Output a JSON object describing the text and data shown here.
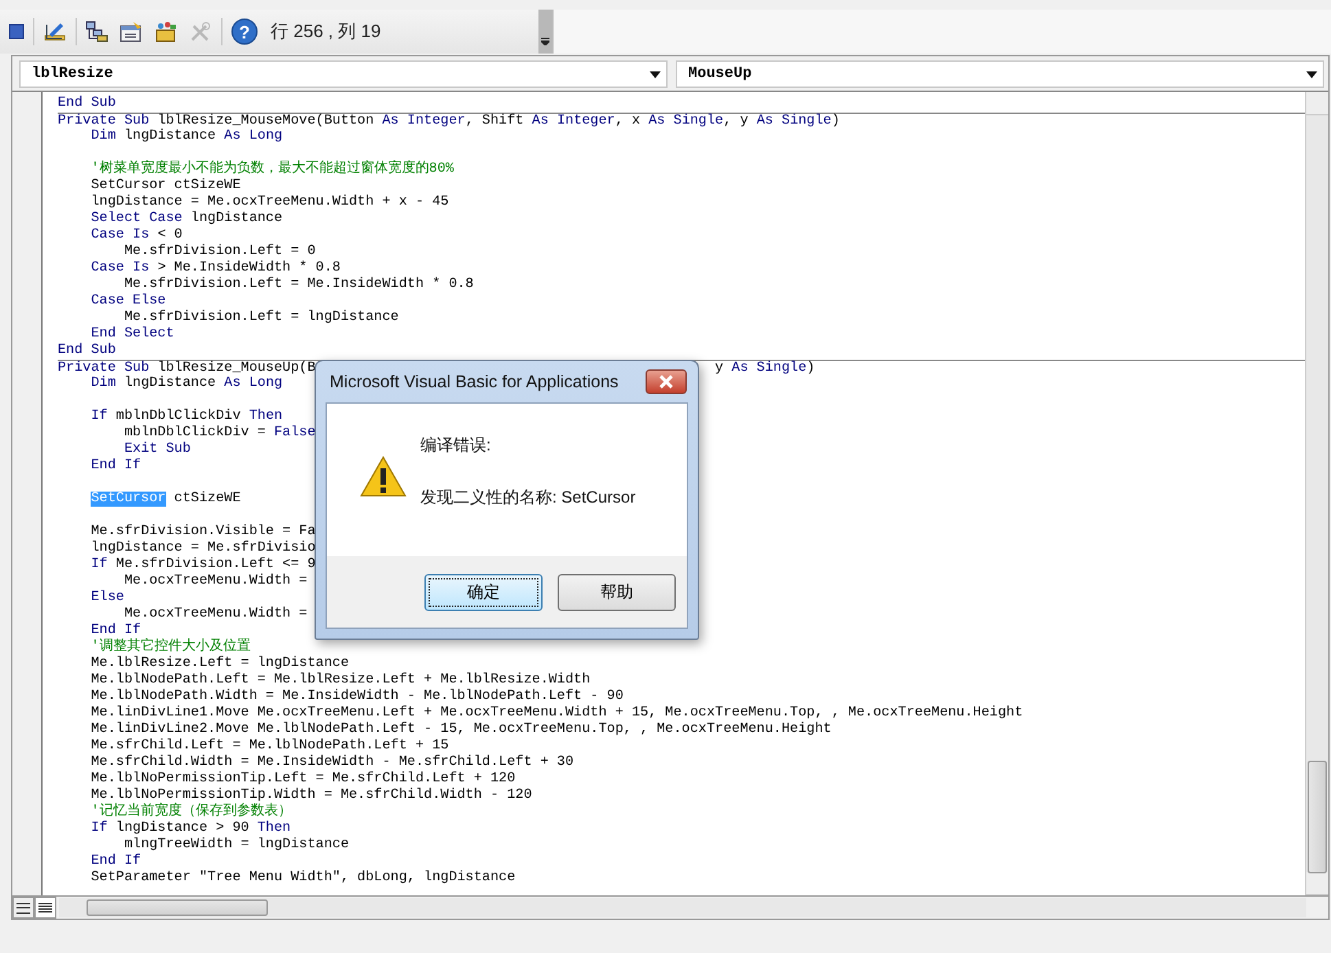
{
  "toolbar": {
    "tools": [
      {
        "kind": "stop",
        "disabled": false
      },
      {
        "kind": "design",
        "disabled": false
      },
      {
        "kind": "project",
        "disabled": false
      },
      {
        "kind": "properties",
        "disabled": false
      },
      {
        "kind": "browser",
        "disabled": false
      },
      {
        "kind": "tools",
        "disabled": true
      },
      {
        "kind": "help",
        "disabled": false,
        "glyph": "?"
      }
    ],
    "position": "行 256 , 列 19"
  },
  "object_combo": {
    "value": "lblResize"
  },
  "procedure_combo": {
    "value": "MouseUp"
  },
  "code_lines": [
    {
      "kind": "code",
      "separator": false,
      "tokens": [
        {
          "kind": "kw",
          "text": "End Sub"
        }
      ]
    },
    {
      "kind": "code",
      "separator": true,
      "tokens": [
        {
          "kind": "kw",
          "text": "Private Sub "
        },
        {
          "kind": "id",
          "text": "lblResize_MouseMove(Button "
        },
        {
          "kind": "kw",
          "text": "As Integer"
        },
        {
          "kind": "id",
          "text": ", Shift "
        },
        {
          "kind": "kw",
          "text": "As Integer"
        },
        {
          "kind": "id",
          "text": ", x "
        },
        {
          "kind": "kw",
          "text": "As Single"
        },
        {
          "kind": "id",
          "text": ", y "
        },
        {
          "kind": "kw",
          "text": "As Single"
        },
        {
          "kind": "id",
          "text": ")"
        }
      ]
    },
    {
      "kind": "code",
      "separator": false,
      "tokens": [
        {
          "kind": "kw",
          "text": "    Dim"
        },
        {
          "kind": "id",
          "text": " lngDistance "
        },
        {
          "kind": "kw",
          "text": "As Long"
        }
      ]
    },
    {
      "kind": "blank",
      "separator": false
    },
    {
      "kind": "code",
      "separator": false,
      "tokens": [
        {
          "kind": "comment",
          "text": "    '树菜单宽度最小不能为负数，最大不能超过窗体宽度的80%"
        }
      ]
    },
    {
      "kind": "code",
      "separator": false,
      "tokens": [
        {
          "kind": "id",
          "text": "    SetCursor ctSizeWE"
        }
      ]
    },
    {
      "kind": "code",
      "separator": false,
      "tokens": [
        {
          "kind": "id",
          "text": "    lngDistance = Me.ocxTreeMenu.Width + x - 45"
        }
      ]
    },
    {
      "kind": "code",
      "separator": false,
      "tokens": [
        {
          "kind": "kw",
          "text": "    Select Case"
        },
        {
          "kind": "id",
          "text": " lngDistance"
        }
      ]
    },
    {
      "kind": "code",
      "separator": false,
      "tokens": [
        {
          "kind": "kw",
          "text": "    Case Is"
        },
        {
          "kind": "id",
          "text": " < 0"
        }
      ]
    },
    {
      "kind": "code",
      "separator": false,
      "tokens": [
        {
          "kind": "id",
          "text": "        Me.sfrDivision.Left = 0"
        }
      ]
    },
    {
      "kind": "code",
      "separator": false,
      "tokens": [
        {
          "kind": "kw",
          "text": "    Case Is"
        },
        {
          "kind": "id",
          "text": " > Me.InsideWidth * 0.8"
        }
      ]
    },
    {
      "kind": "code",
      "separator": false,
      "tokens": [
        {
          "kind": "id",
          "text": "        Me.sfrDivision.Left = Me.InsideWidth * 0.8"
        }
      ]
    },
    {
      "kind": "code",
      "separator": false,
      "tokens": [
        {
          "kind": "kw",
          "text": "    Case Else"
        }
      ]
    },
    {
      "kind": "code",
      "separator": false,
      "tokens": [
        {
          "kind": "id",
          "text": "        Me.sfrDivision.Left = lngDistance"
        }
      ]
    },
    {
      "kind": "code",
      "separator": false,
      "tokens": [
        {
          "kind": "kw",
          "text": "    End Select"
        }
      ]
    },
    {
      "kind": "code",
      "separator": false,
      "tokens": [
        {
          "kind": "kw",
          "text": "End Sub"
        }
      ]
    },
    {
      "kind": "code",
      "separator": true,
      "tokens": [
        {
          "kind": "kw",
          "text": "Private Sub "
        },
        {
          "kind": "id",
          "text": "lblResize_MouseUp(B"
        }
      ],
      "tail": [
        {
          "kind": "id",
          "text": "y "
        },
        {
          "kind": "kw",
          "text": "As Single"
        },
        {
          "kind": "id",
          "text": ")"
        }
      ]
    },
    {
      "kind": "code",
      "separator": false,
      "tokens": [
        {
          "kind": "kw",
          "text": "    Dim"
        },
        {
          "kind": "id",
          "text": " lngDistance "
        },
        {
          "kind": "kw",
          "text": "As Long"
        }
      ]
    },
    {
      "kind": "blank",
      "separator": false
    },
    {
      "kind": "code",
      "separator": false,
      "tokens": [
        {
          "kind": "kw",
          "text": "    If"
        },
        {
          "kind": "id",
          "text": " mblnDblClickDiv "
        },
        {
          "kind": "kw",
          "text": "Then"
        }
      ]
    },
    {
      "kind": "code",
      "separator": false,
      "tokens": [
        {
          "kind": "id",
          "text": "        mblnDblClickDiv = "
        },
        {
          "kind": "kw",
          "text": "False"
        }
      ]
    },
    {
      "kind": "code",
      "separator": false,
      "tokens": [
        {
          "kind": "kw",
          "text": "        Exit Sub"
        }
      ]
    },
    {
      "kind": "code",
      "separator": false,
      "tokens": [
        {
          "kind": "kw",
          "text": "    End If"
        }
      ]
    },
    {
      "kind": "blank",
      "separator": false
    },
    {
      "kind": "code",
      "separator": false,
      "indented": true,
      "tokens": [
        {
          "kind": "sel",
          "text": "SetCursor"
        },
        {
          "kind": "id",
          "text": " ctSizeWE"
        }
      ]
    },
    {
      "kind": "blank",
      "separator": false
    },
    {
      "kind": "code",
      "separator": false,
      "tokens": [
        {
          "kind": "id",
          "text": "    Me.sfrDivision.Visible = Fa"
        }
      ]
    },
    {
      "kind": "code",
      "separator": false,
      "tokens": [
        {
          "kind": "id",
          "text": "    lngDistance = Me.sfrDivisio"
        }
      ]
    },
    {
      "kind": "code",
      "separator": false,
      "tokens": [
        {
          "kind": "kw",
          "text": "    If"
        },
        {
          "kind": "id",
          "text": " Me.sfrDivision.Left <= 9"
        }
      ]
    },
    {
      "kind": "code",
      "separator": false,
      "tokens": [
        {
          "kind": "id",
          "text": "        Me.ocxTreeMenu.Width ="
        }
      ]
    },
    {
      "kind": "code",
      "separator": false,
      "tokens": [
        {
          "kind": "kw",
          "text": "    Else"
        }
      ]
    },
    {
      "kind": "code",
      "separator": false,
      "tokens": [
        {
          "kind": "id",
          "text": "        Me.ocxTreeMenu.Width ="
        }
      ]
    },
    {
      "kind": "code",
      "separator": false,
      "tokens": [
        {
          "kind": "kw",
          "text": "    End If"
        }
      ]
    },
    {
      "kind": "code",
      "separator": false,
      "tokens": [
        {
          "kind": "comment",
          "text": "    '调整其它控件大小及位置"
        }
      ]
    },
    {
      "kind": "code",
      "separator": false,
      "tokens": [
        {
          "kind": "id",
          "text": "    Me.lblResize.Left = lngDistance"
        }
      ]
    },
    {
      "kind": "code",
      "separator": false,
      "tokens": [
        {
          "kind": "id",
          "text": "    Me.lblNodePath.Left = Me.lblResize.Left + Me.lblResize.Width"
        }
      ]
    },
    {
      "kind": "code",
      "separator": false,
      "tokens": [
        {
          "kind": "id",
          "text": "    Me.lblNodePath.Width = Me.InsideWidth - Me.lblNodePath.Left - 90"
        }
      ]
    },
    {
      "kind": "code",
      "separator": false,
      "tokens": [
        {
          "kind": "id",
          "text": "    Me.linDivLine1.Move Me.ocxTreeMenu.Left + Me.ocxTreeMenu.Width + 15, Me.ocxTreeMenu.Top, , Me.ocxTreeMenu.Height"
        }
      ]
    },
    {
      "kind": "code",
      "separator": false,
      "tokens": [
        {
          "kind": "id",
          "text": "    Me.linDivLine2.Move Me.lblNodePath.Left - 15, Me.ocxTreeMenu.Top, , Me.ocxTreeMenu.Height"
        }
      ]
    },
    {
      "kind": "code",
      "separator": false,
      "tokens": [
        {
          "kind": "id",
          "text": "    Me.sfrChild.Left = Me.lblNodePath.Left + 15"
        }
      ]
    },
    {
      "kind": "code",
      "separator": false,
      "tokens": [
        {
          "kind": "id",
          "text": "    Me.sfrChild.Width = Me.InsideWidth - Me.sfrChild.Left + 30"
        }
      ]
    },
    {
      "kind": "code",
      "separator": false,
      "tokens": [
        {
          "kind": "id",
          "text": "    Me.lblNoPermissionTip.Left = Me.sfrChild.Left + 120"
        }
      ]
    },
    {
      "kind": "code",
      "separator": false,
      "tokens": [
        {
          "kind": "id",
          "text": "    Me.lblNoPermissionTip.Width = Me.sfrChild.Width - 120"
        }
      ]
    },
    {
      "kind": "code",
      "separator": false,
      "tokens": [
        {
          "kind": "comment",
          "text": "    '记忆当前宽度（保存到参数表）"
        }
      ]
    },
    {
      "kind": "code",
      "separator": false,
      "tokens": [
        {
          "kind": "kw",
          "text": "    If"
        },
        {
          "kind": "id",
          "text": " lngDistance > 90 "
        },
        {
          "kind": "kw",
          "text": "Then"
        }
      ]
    },
    {
      "kind": "code",
      "separator": false,
      "tokens": [
        {
          "kind": "id",
          "text": "        mlngTreeWidth = lngDistance"
        }
      ]
    },
    {
      "kind": "code",
      "separator": false,
      "tokens": [
        {
          "kind": "kw",
          "text": "    End If"
        }
      ]
    },
    {
      "kind": "code",
      "separator": false,
      "tokens": [
        {
          "kind": "id",
          "text": "    SetParameter \"Tree Menu Width\", dbLong, lngDistance"
        }
      ]
    }
  ],
  "dialog": {
    "title": "Microsoft Visual Basic for Applications",
    "heading": "编译错误:",
    "message": "发现二义性的名称: SetCursor",
    "buttons": [
      {
        "label": "确定",
        "focused": true
      },
      {
        "label": "帮助",
        "focused": false
      }
    ]
  }
}
